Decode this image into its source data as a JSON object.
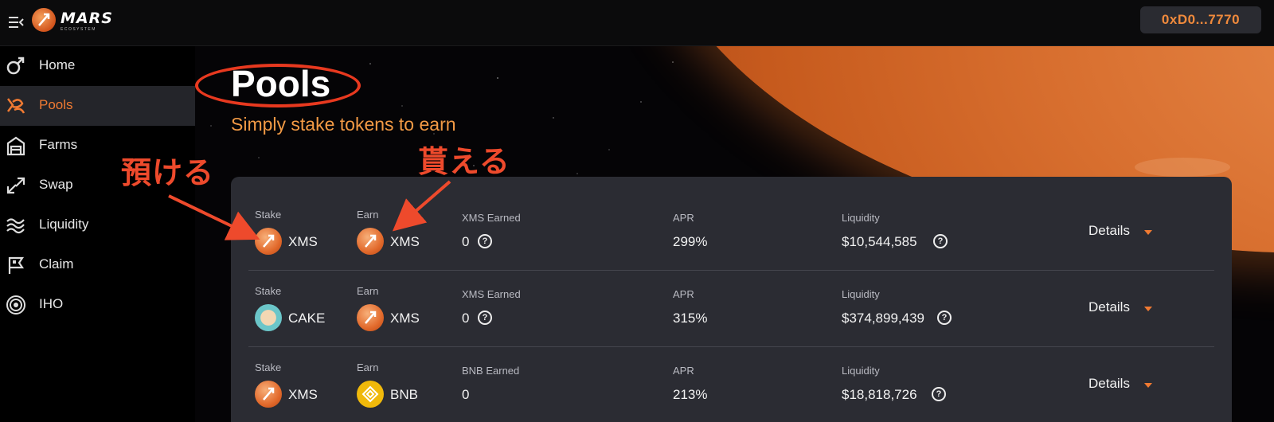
{
  "header": {
    "logo_text": "MARS",
    "logo_sub": "ECOSYSTEM",
    "wallet_address": "0xD0...7770"
  },
  "sidebar": {
    "items": [
      {
        "label": "Home",
        "icon": "mars-symbol-icon"
      },
      {
        "label": "Pools",
        "icon": "pools-icon",
        "active": true
      },
      {
        "label": "Farms",
        "icon": "barn-icon"
      },
      {
        "label": "Swap",
        "icon": "swap-arrows-icon"
      },
      {
        "label": "Liquidity",
        "icon": "liquidity-waves-icon"
      },
      {
        "label": "Claim",
        "icon": "flag-icon"
      },
      {
        "label": "IHO",
        "icon": "broadcast-icon"
      }
    ]
  },
  "main": {
    "title": "Pools",
    "subtitle": "Simply stake tokens to earn"
  },
  "annotations": {
    "deposit": "預ける",
    "receive": "貰える"
  },
  "pools": [
    {
      "stake_label": "Stake",
      "stake_token": "XMS",
      "stake_icon": "xms-token-icon",
      "earn_label": "Earn",
      "earn_token": "XMS",
      "earn_icon": "xms-token-icon",
      "earned_label": "XMS Earned",
      "earned_value": "0",
      "apr_label": "APR",
      "apr_value": "299%",
      "liquidity_label": "Liquidity",
      "liquidity_value": "$10,544,585",
      "details_label": "Details"
    },
    {
      "stake_label": "Stake",
      "stake_token": "CAKE",
      "stake_icon": "cake-token-icon",
      "earn_label": "Earn",
      "earn_token": "XMS",
      "earn_icon": "xms-token-icon",
      "earned_label": "XMS Earned",
      "earned_value": "0",
      "apr_label": "APR",
      "apr_value": "315%",
      "liquidity_label": "Liquidity",
      "liquidity_value": "$374,899,439",
      "details_label": "Details"
    },
    {
      "stake_label": "Stake",
      "stake_token": "XMS",
      "stake_icon": "xms-token-icon",
      "earn_label": "Earn",
      "earn_token": "BNB",
      "earn_icon": "bnb-token-icon",
      "earned_label": "BNB Earned",
      "earned_value": "0",
      "apr_label": "APR",
      "apr_value": "213%",
      "liquidity_label": "Liquidity",
      "liquidity_value": "$18,818,726",
      "details_label": "Details"
    }
  ],
  "colors": {
    "accent": "#f07a32",
    "annotation": "#ee4a2c",
    "card": "#2b2c33"
  }
}
